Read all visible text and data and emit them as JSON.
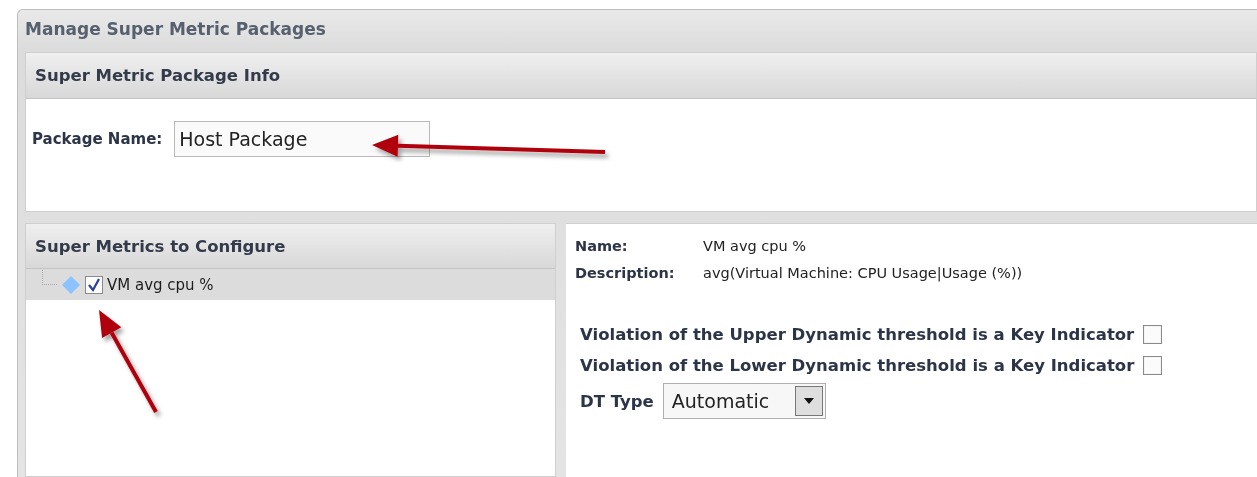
{
  "window": {
    "title": "Manage Super Metric Packages"
  },
  "info_panel": {
    "title": "Super Metric Package Info",
    "package_name": {
      "label": "Package Name:",
      "value": "Host Package"
    }
  },
  "metrics_panel": {
    "title": "Super Metrics to Configure",
    "items": [
      {
        "label": "VM avg cpu %",
        "checked": true,
        "selected": true
      }
    ]
  },
  "details": {
    "fields": [
      {
        "label": "Name:",
        "value": "VM avg cpu %"
      },
      {
        "label": "Description:",
        "value": "avg(Virtual Machine: CPU Usage|Usage (%))"
      }
    ],
    "options": [
      {
        "label": "Violation of the Upper Dynamic threshold is a Key Indicator",
        "checked": false
      },
      {
        "label": "Violation of the Lower Dynamic threshold is a Key Indicator",
        "checked": false
      }
    ],
    "dt_type": {
      "label": "DT Type",
      "value": "Automatic"
    }
  }
}
